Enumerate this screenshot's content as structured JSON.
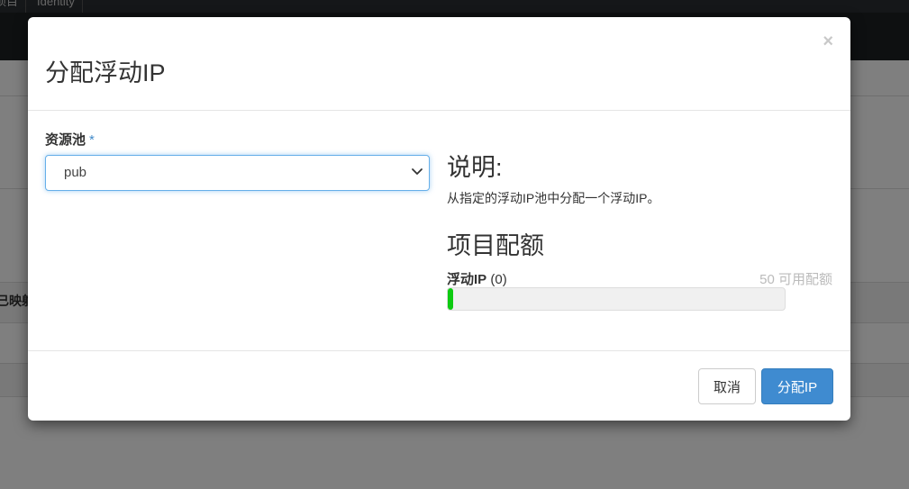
{
  "background": {
    "tabs": [
      "项目",
      "Identity"
    ],
    "table_header_fragment": "已映射"
  },
  "modal": {
    "title": "分配浮动IP",
    "close_glyph": "×",
    "pool_field": {
      "label": "资源池",
      "required_marker": "*",
      "selected_value": "pub"
    },
    "description": {
      "heading": "说明:",
      "text": "从指定的浮动IP池中分配一个浮动IP。"
    },
    "quota": {
      "heading": "项目配额",
      "item_name": "浮动IP",
      "item_used": "(0)",
      "available_text": "50 可用配额",
      "used_fraction": 0.0
    },
    "buttons": {
      "cancel": "取消",
      "submit": "分配IP"
    }
  },
  "colors": {
    "primary": "#3f8bd0",
    "progress": "#0dcb11",
    "focus_border": "#66afe9"
  }
}
